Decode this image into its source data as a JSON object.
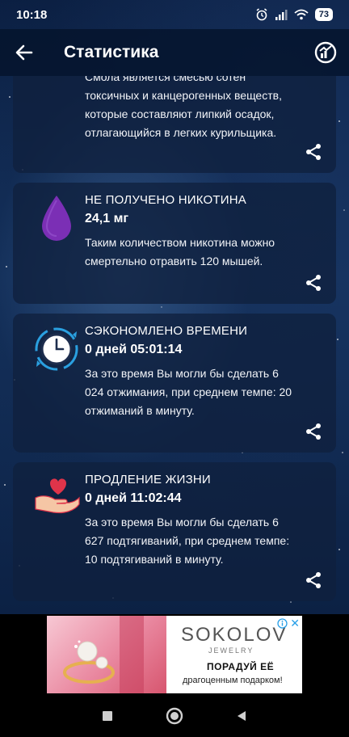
{
  "status_bar": {
    "time": "10:18",
    "battery": "73"
  },
  "app_bar": {
    "title": "Статистика"
  },
  "cards": [
    {
      "title": "",
      "value": "",
      "desc_lines": [
        "Смола является смесью сотен",
        "токсичных и канцерогенных веществ,",
        "которые составляют липкий осадок,",
        "отлагающийся в легких курильщика."
      ]
    },
    {
      "title": "НЕ ПОЛУЧЕНО НИКОТИНА",
      "value": "24,1 мг",
      "desc_lines": [
        "Таким количеством никотина можно",
        "смертельно отравить 120 мышей."
      ]
    },
    {
      "title": "СЭКОНОМЛЕНО ВРЕМЕНИ",
      "value": "0 дней 05:01:14",
      "desc_lines": [
        "За это время Вы могли бы сделать 6",
        "024 отжимания, при среднем темпе: 20",
        "отжиманий в минуту."
      ]
    },
    {
      "title": "ПРОДЛЕНИЕ ЖИЗНИ",
      "value": "0 дней 11:02:44",
      "desc_lines": [
        "За это время Вы могли бы сделать 6",
        "627 подтягиваний, при среднем темпе:",
        "10 подтягиваний в минуту."
      ]
    }
  ],
  "ad": {
    "brand": "SOKOLOV",
    "sub": "JEWELRY",
    "headline": "ПОРАДУЙ ЕЁ",
    "text": "драгоценным подарком!",
    "close": "✕"
  },
  "colors": {
    "accent_purple": "#7b2fb5",
    "clock_blue": "#2aa0e0",
    "heart_red": "#e0344a"
  }
}
